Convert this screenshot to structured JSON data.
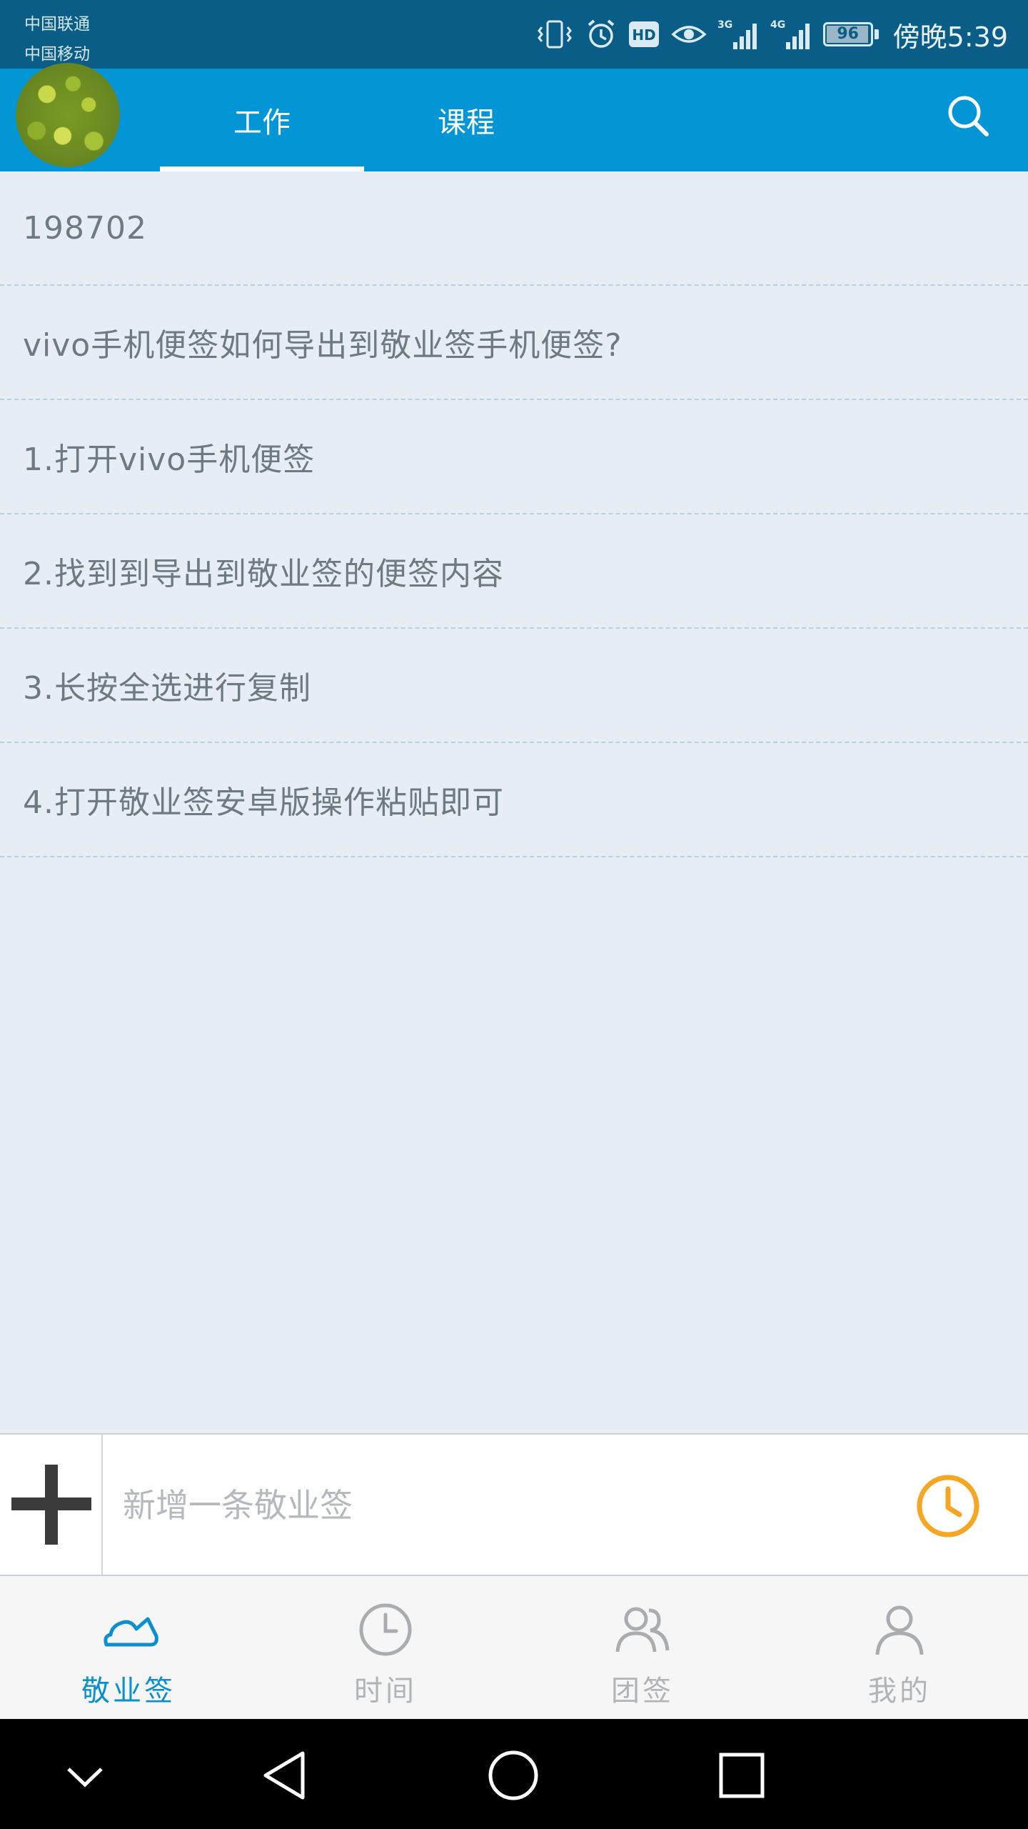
{
  "status_bar": {
    "carrier_1": "中国联通",
    "carrier_2": "中国移动",
    "network_1": "3G",
    "network_2": "4G",
    "battery_percent": "96",
    "time": "傍晚5:39"
  },
  "header": {
    "tabs": [
      {
        "label": "工作",
        "active": true
      },
      {
        "label": "课程",
        "active": false
      }
    ],
    "search_icon": "search-icon",
    "accent_color": "#0296d6"
  },
  "notes": [
    "198702",
    "vivo手机便签如何导出到敬业签手机便签?",
    "1.打开vivo手机便签",
    "2.找到到导出到敬业签的便签内容",
    "3.长按全选进行复制",
    "4.打开敬业签安卓版操作粘贴即可"
  ],
  "composer": {
    "placeholder": "新增一条敬业签",
    "add_icon": "plus-icon",
    "reminder_icon": "clock-icon",
    "reminder_color": "#f5a623"
  },
  "bottom_nav": [
    {
      "label": "敬业签",
      "icon": "cloud-icon",
      "active": true
    },
    {
      "label": "时间",
      "icon": "clock-icon",
      "active": false
    },
    {
      "label": "团签",
      "icon": "group-icon",
      "active": false
    },
    {
      "label": "我的",
      "icon": "person-icon",
      "active": false
    }
  ],
  "system_nav": [
    "collapse-icon",
    "back-icon",
    "home-icon",
    "recents-icon"
  ]
}
